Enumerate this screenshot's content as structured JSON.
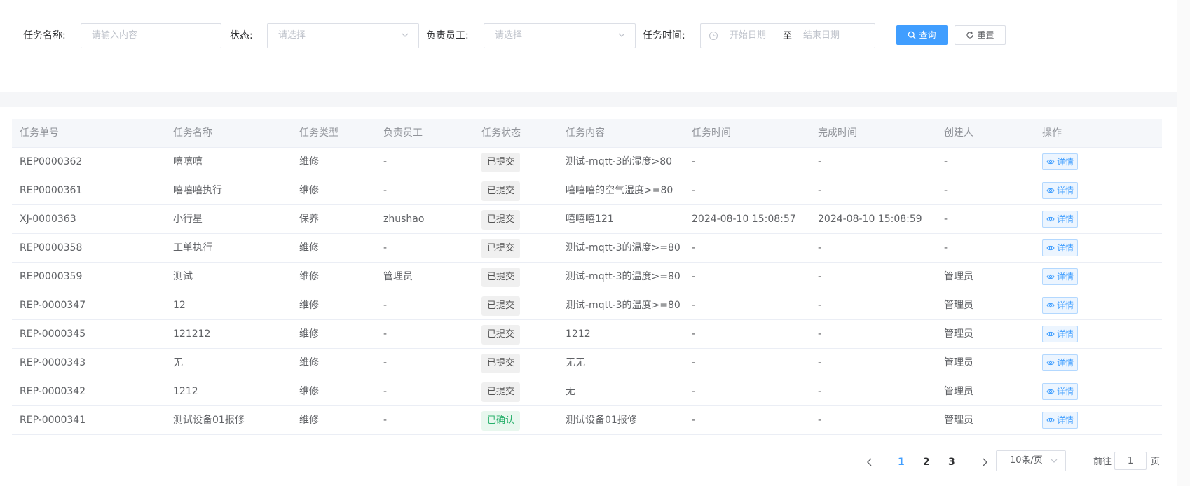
{
  "filters": {
    "task_name_label": "任务名称:",
    "task_name_placeholder": "请输入内容",
    "status_label": "状态:",
    "status_placeholder": "请选择",
    "employee_label": "负责员工:",
    "employee_placeholder": "请选择",
    "task_time_label": "任务时间:",
    "start_date_placeholder": "开始日期",
    "date_separator": "至",
    "end_date_placeholder": "结束日期",
    "query_button": "查询",
    "reset_button": "重置"
  },
  "table": {
    "columns": [
      "任务单号",
      "任务名称",
      "任务类型",
      "负责员工",
      "任务状态",
      "任务内容",
      "任务时间",
      "完成时间",
      "创建人",
      "操作"
    ],
    "detail_label": "详情",
    "rows": [
      [
        "REP0000362",
        "嘻嘻嘻",
        "维修",
        "-",
        "已提交",
        "测试-mqtt-3的湿度>80",
        "-",
        "-",
        "-"
      ],
      [
        "REP0000361",
        "嘻嘻嘻执行",
        "维修",
        "-",
        "已提交",
        "嘻嘻嘻的空气湿度>=80",
        "-",
        "-",
        "-"
      ],
      [
        "XJ-0000363",
        "小行星",
        "保养",
        "zhushao",
        "已提交",
        "嘻嘻嘻121",
        "2024-08-10 15:08:57",
        "2024-08-10 15:08:59",
        "-"
      ],
      [
        "REP0000358",
        "工单执行",
        "维修",
        "-",
        "已提交",
        "测试-mqtt-3的温度>=80",
        "-",
        "-",
        "-"
      ],
      [
        "REP0000359",
        "测试",
        "维修",
        "管理员",
        "已提交",
        "测试-mqtt-3的温度>=80",
        "-",
        "-",
        "管理员"
      ],
      [
        "REP-0000347",
        "12",
        "维修",
        "-",
        "已提交",
        "测试-mqtt-3的温度>=80",
        "-",
        "-",
        "管理员"
      ],
      [
        "REP-0000345",
        "121212",
        "维修",
        "-",
        "已提交",
        "1212",
        "-",
        "-",
        "管理员"
      ],
      [
        "REP-0000343",
        "无",
        "维修",
        "-",
        "已提交",
        "无无",
        "-",
        "-",
        "管理员"
      ],
      [
        "REP-0000342",
        "1212",
        "维修",
        "-",
        "已提交",
        "无",
        "-",
        "-",
        "管理员"
      ],
      [
        "REP-0000341",
        "测试设备01报修",
        "维修",
        "-",
        "已确认",
        "测试设备01报修",
        "-",
        "-",
        "管理员"
      ]
    ]
  },
  "pagination": {
    "pages": [
      "1",
      "2",
      "3"
    ],
    "current_page": "1",
    "page_size": "10条/页",
    "goto_label": "前往",
    "goto_value": "1",
    "page_suffix": "页"
  },
  "colors": {
    "primary": "#409eff",
    "submitted_tag_bg": "#f0f0f0",
    "confirmed_tag_bg": "#e8f7ee",
    "confirmed_tag_text": "#27b06b"
  }
}
